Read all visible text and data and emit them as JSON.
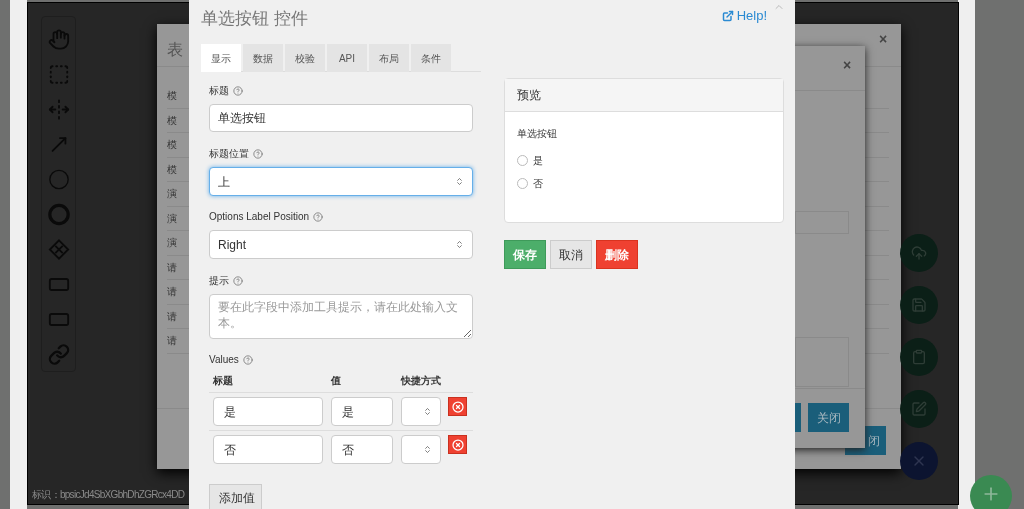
{
  "background": {
    "form_dialog": {
      "title": "表",
      "rows": [
        "模",
        "模",
        "模",
        "模",
        "演",
        "演",
        "演",
        "请",
        "请",
        "请",
        "请"
      ],
      "close_button": "×",
      "footer_button": "闭"
    },
    "inner_dialog": {
      "close_button": "×",
      "footer_button": "关闭"
    },
    "footer_id": "标识：bpsicJd4SbXGbhDhZGRcx4DD"
  },
  "modal": {
    "title": "单选按钮 控件",
    "help": "Help!",
    "tabs": [
      {
        "label": "显示",
        "selected": true
      },
      {
        "label": "数据",
        "selected": false
      },
      {
        "label": "校验",
        "selected": false
      },
      {
        "label": "API",
        "selected": false
      },
      {
        "label": "布局",
        "selected": false
      },
      {
        "label": "条件",
        "selected": false
      }
    ],
    "label_field": {
      "label": "标题",
      "value": "单选按钮"
    },
    "label_position": {
      "label": "标题位置",
      "value": "上",
      "focused": true
    },
    "options_label_position": {
      "label": "Options Label Position",
      "value": "Right",
      "focused": false
    },
    "tooltip": {
      "label": "提示",
      "placeholder": "要在此字段中添加工具提示，请在此处输入文本。"
    },
    "values": {
      "label": "Values",
      "columns": [
        "标题",
        "值",
        "快捷方式"
      ],
      "rows": [
        {
          "label": "是",
          "value": "是"
        },
        {
          "label": "否",
          "value": "否"
        }
      ],
      "add_button": "添加值"
    },
    "preview": {
      "title": "预览",
      "field_label": "单选按钮",
      "options": [
        {
          "label": "是",
          "selected": false
        },
        {
          "label": "否",
          "selected": false
        }
      ]
    },
    "buttons": [
      {
        "label": "保存",
        "kind": "save"
      },
      {
        "label": "取消",
        "kind": "cancel"
      },
      {
        "label": "删除",
        "kind": "delete"
      }
    ]
  }
}
